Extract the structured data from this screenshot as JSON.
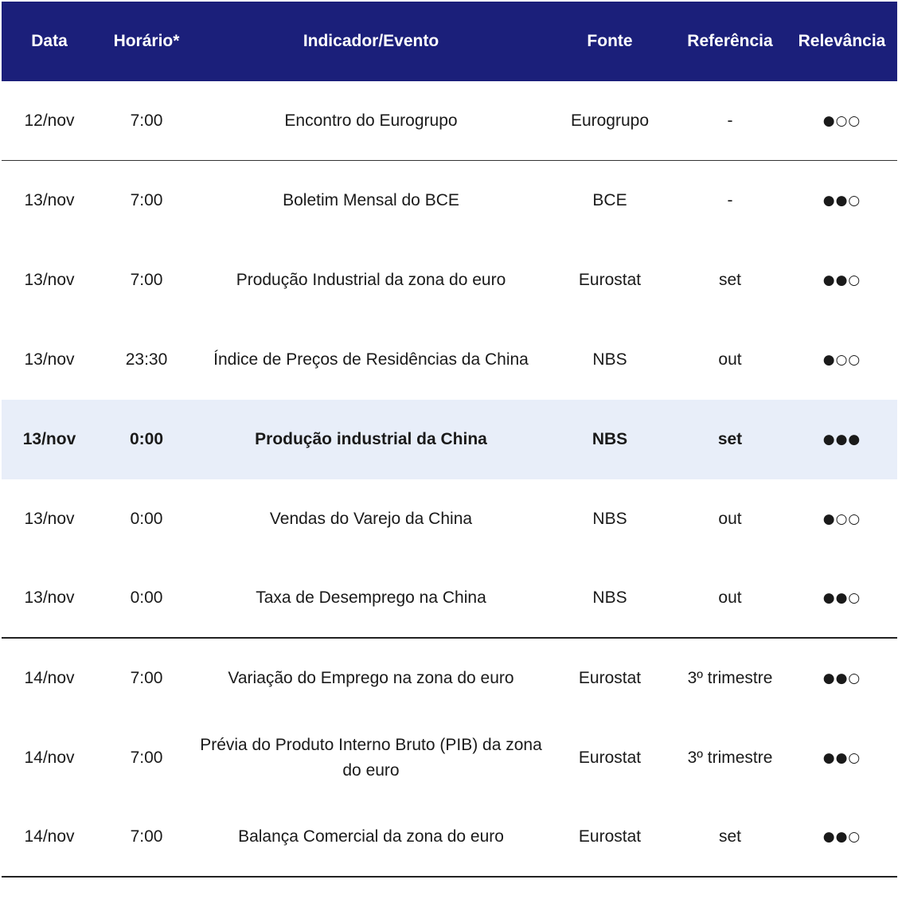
{
  "header": {
    "date": "Data",
    "time": "Horário*",
    "event": "Indicador/Evento",
    "source": "Fonte",
    "reference": "Referência",
    "relevance": "Relevância"
  },
  "colors": {
    "header_bg": "#1b1f7a",
    "highlight_bg": "#e8eef9"
  },
  "rows": [
    {
      "date": "12/nov",
      "time": "7:00",
      "event": "Encontro do Eurogrupo",
      "source": "Eurogrupo",
      "reference": "-",
      "relevance": "●○○"
    },
    {
      "date": "13/nov",
      "time": "7:00",
      "event": "Boletim Mensal do BCE",
      "source": "BCE",
      "reference": "-",
      "relevance": "●●○"
    },
    {
      "date": "13/nov",
      "time": "7:00",
      "event": "Produção Industrial da zona do euro",
      "source": "Eurostat",
      "reference": "set",
      "relevance": "●●○"
    },
    {
      "date": "13/nov",
      "time": "23:30",
      "event": "Índice de Preços de Residências da China",
      "source": "NBS",
      "reference": "out",
      "relevance": "●○○"
    },
    {
      "date": "13/nov",
      "time": "0:00",
      "event": "Produção industrial da China",
      "source": "NBS",
      "reference": "set",
      "relevance": "●●●"
    },
    {
      "date": "13/nov",
      "time": "0:00",
      "event": "Vendas do Varejo da China",
      "source": "NBS",
      "reference": "out",
      "relevance": "●○○"
    },
    {
      "date": "13/nov",
      "time": "0:00",
      "event": "Taxa de Desemprego na China",
      "source": "NBS",
      "reference": "out",
      "relevance": "●●○"
    },
    {
      "date": "14/nov",
      "time": "7:00",
      "event": "Variação do Emprego na zona do euro",
      "source": "Eurostat",
      "reference": "3º trimestre",
      "relevance": "●●○"
    },
    {
      "date": "14/nov",
      "time": "7:00",
      "event": "Prévia do Produto Interno Bruto (PIB) da zona do euro",
      "source": "Eurostat",
      "reference": "3º trimestre",
      "relevance": "●●○"
    },
    {
      "date": "14/nov",
      "time": "7:00",
      "event": "Balança Comercial da zona do euro",
      "source": "Eurostat",
      "reference": "set",
      "relevance": "●●○"
    }
  ]
}
